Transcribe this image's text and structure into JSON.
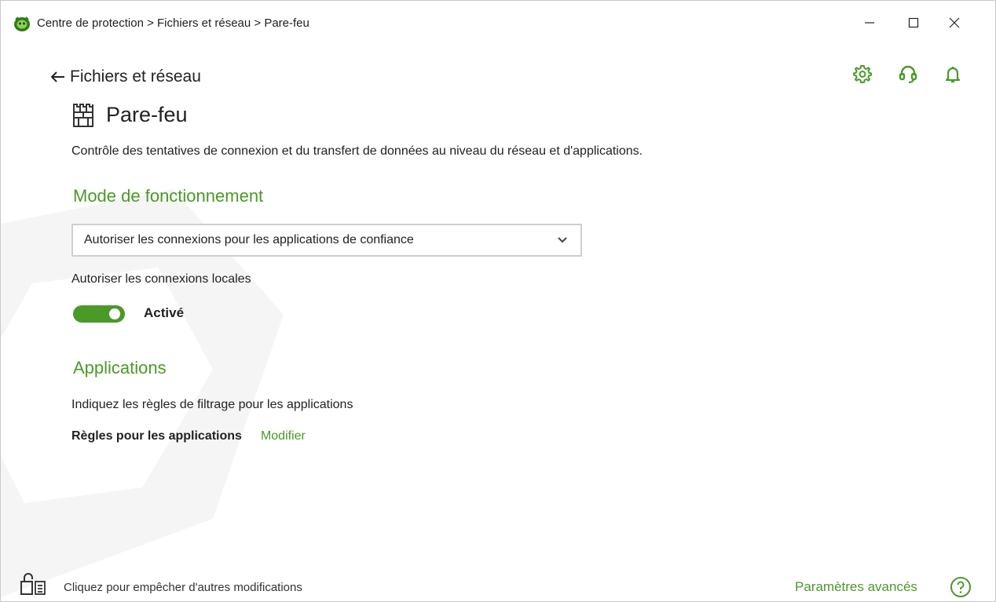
{
  "window": {
    "title": "Centre de protection > Fichiers et réseau > Pare-feu",
    "buttons": {
      "minimize": "minimize-icon",
      "maximize": "maximize-icon",
      "close": "close-icon"
    }
  },
  "header_icons": [
    "gear-icon",
    "headset-support-icon",
    "bell-icon"
  ],
  "nav": {
    "back_label": "Fichiers et réseau"
  },
  "page": {
    "title": "Pare-feu",
    "icon": "firewall-icon",
    "description": "Contrôle des tentatives de connexion et du transfert de données au niveau du réseau et d'applications."
  },
  "mode": {
    "heading": "Mode de fonctionnement",
    "selected": "Autoriser les connexions pour les applications de confiance"
  },
  "local_connections": {
    "label": "Autoriser les connexions locales",
    "toggle_state": "Activé",
    "enabled": true
  },
  "applications": {
    "heading": "Applications",
    "description": "Indiquez les règles de filtrage pour les applications",
    "rules_label": "Règles pour les applications",
    "edit_link": "Modifier"
  },
  "footer": {
    "lock_text": "Cliquez pour empêcher d'autres modifications",
    "advanced_link": "Paramètres avancés"
  },
  "colors": {
    "accent": "#4a9a2a",
    "text": "#222222",
    "border": "#cfcfcf"
  }
}
